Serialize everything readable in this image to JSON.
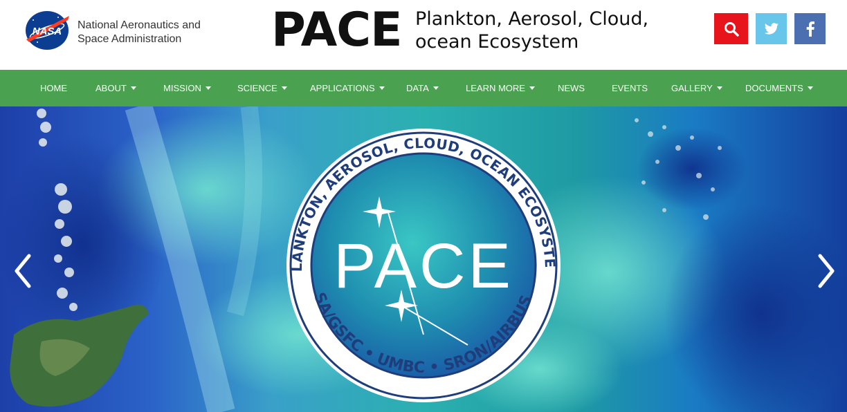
{
  "agency": {
    "logo_text": "NASA",
    "line1": "National Aeronautics and",
    "line2": "Space Administration"
  },
  "mission": {
    "title": "PACE",
    "subtitle_line1": "Plankton, Aerosol, Cloud,",
    "subtitle_line2": "ocean Ecosystem"
  },
  "social": {
    "search_icon": "search-icon",
    "twitter_icon": "twitter-icon",
    "facebook_icon": "facebook-icon",
    "colors": {
      "search": "#e8141c",
      "twitter": "#67c6e9",
      "facebook": "#4b6fb0"
    }
  },
  "nav": {
    "color": "#4aa14f",
    "items": [
      {
        "label": "HOME",
        "has_dropdown": false
      },
      {
        "label": "ABOUT",
        "has_dropdown": true
      },
      {
        "label": "MISSION",
        "has_dropdown": true
      },
      {
        "label": "SCIENCE",
        "has_dropdown": true
      },
      {
        "label": "APPLICATIONS",
        "has_dropdown": true
      },
      {
        "label": "DATA",
        "has_dropdown": true
      },
      {
        "label": "LEARN MORE",
        "has_dropdown": true
      },
      {
        "label": "NEWS",
        "has_dropdown": false
      },
      {
        "label": "EVENTS",
        "has_dropdown": false
      },
      {
        "label": "GALLERY",
        "has_dropdown": true
      },
      {
        "label": "DOCUMENTS",
        "has_dropdown": true
      }
    ]
  },
  "hero": {
    "badge": {
      "ring_top": "PLANKTON, AEROSOL, CLOUD, OCEAN ECOSYSTEM",
      "ring_bottom": "NASA/GSFC • UMBC • SRON/AIRBUS NL",
      "center_text": "PACE"
    },
    "prev_icon": "chevron-left-icon",
    "next_icon": "chevron-right-icon"
  }
}
